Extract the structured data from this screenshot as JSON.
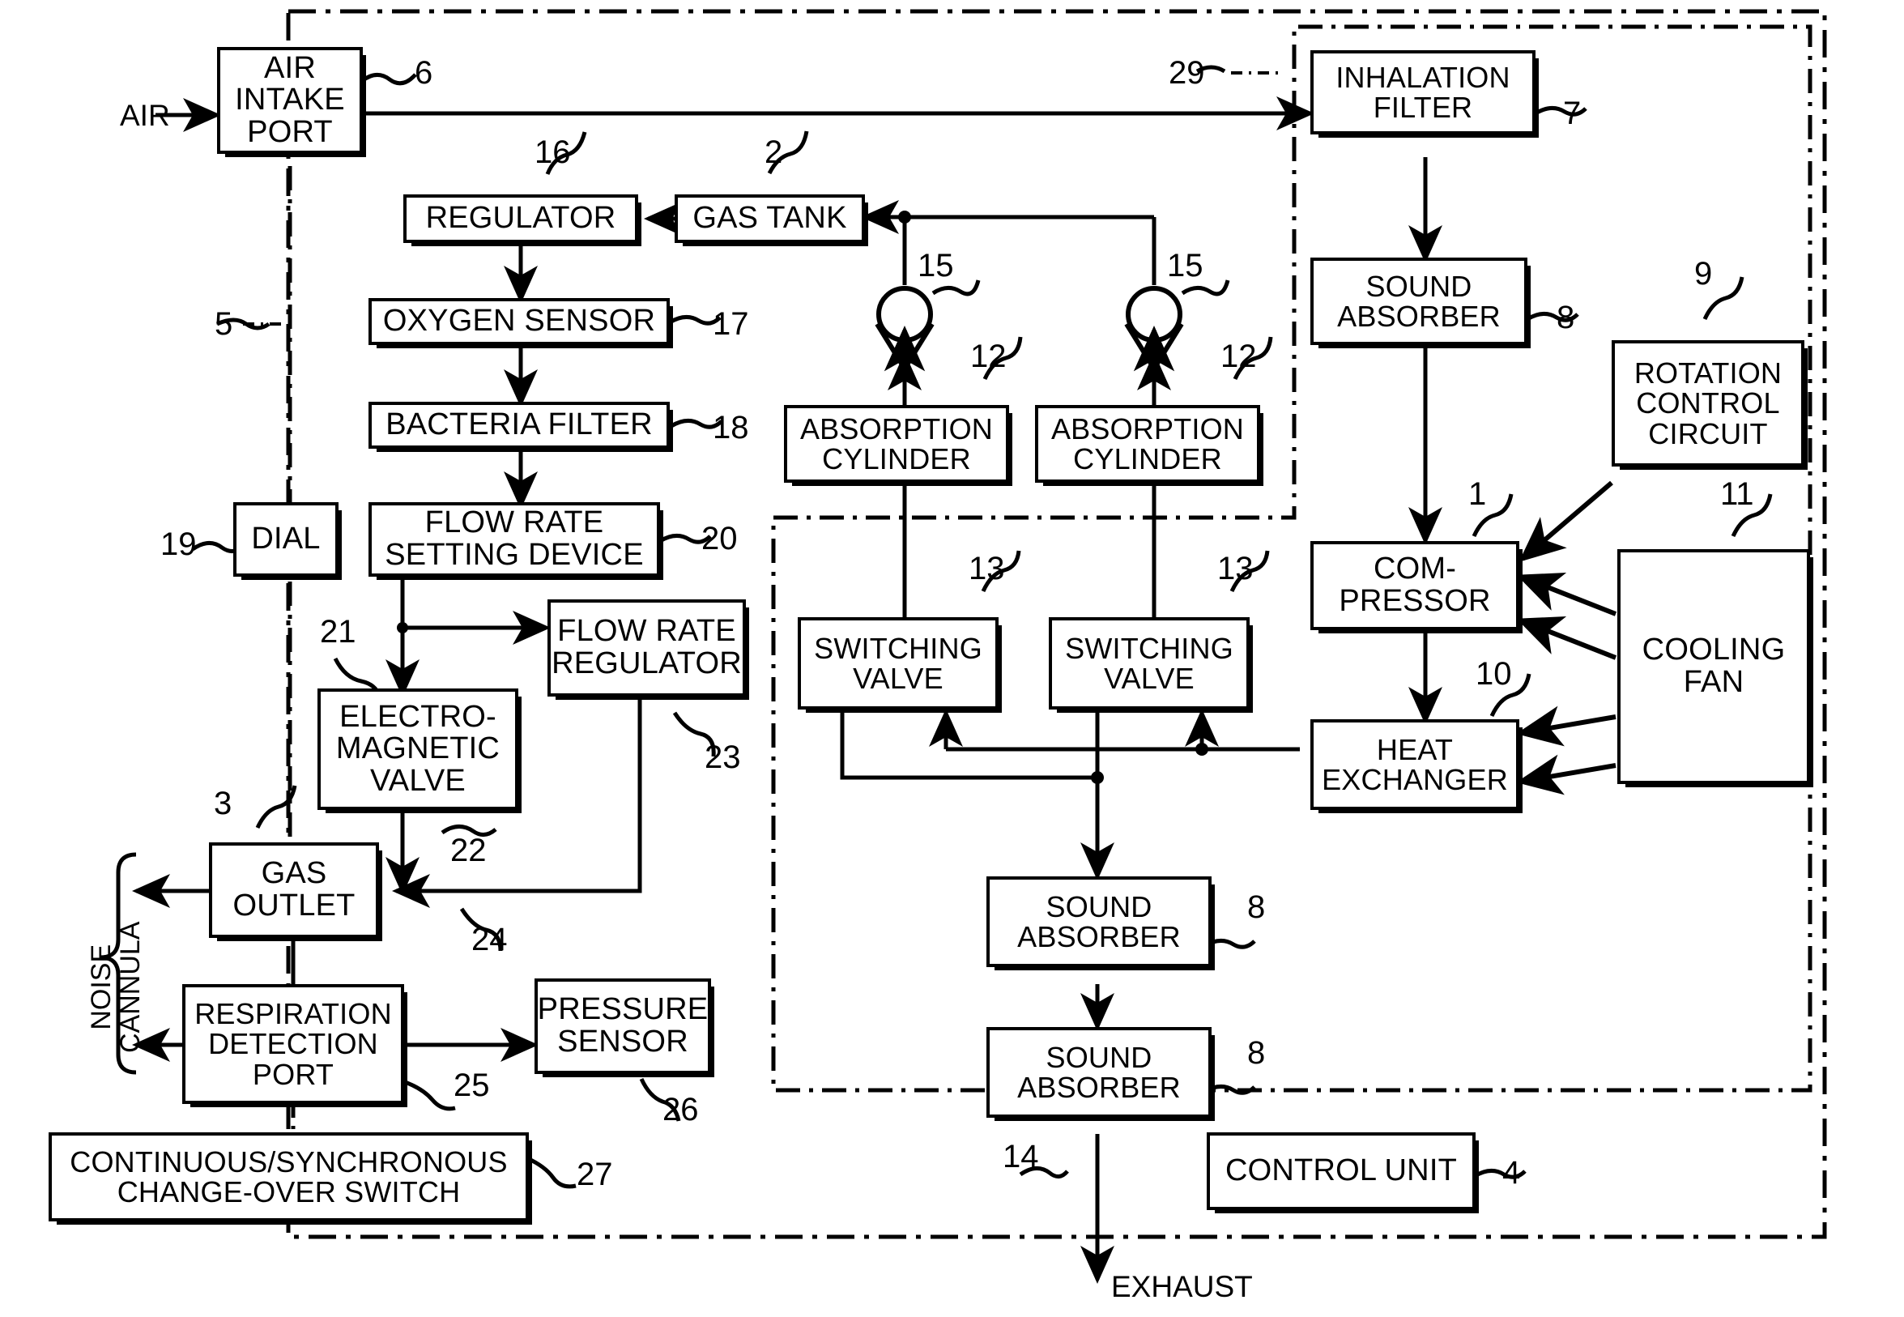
{
  "figure": {
    "type": "patent-block-diagram",
    "title": "Oxygen concentrator block diagram"
  },
  "labels": {
    "air_in": "AIR",
    "exhaust": "EXHAUST",
    "noise_cannula_line1": "NOISE",
    "noise_cannula_line2": "CANNULA"
  },
  "blocks": [
    {
      "id": "air-intake-port",
      "lines": [
        "AIR",
        "INTAKE",
        "PORT"
      ],
      "ref": "6"
    },
    {
      "id": "regulator",
      "lines": [
        "REGULATOR"
      ],
      "ref": "16"
    },
    {
      "id": "gas-tank",
      "lines": [
        "GAS TANK"
      ],
      "ref": "2"
    },
    {
      "id": "oxygen-sensor",
      "lines": [
        "OXYGEN SENSOR"
      ],
      "ref": "17"
    },
    {
      "id": "bacteria-filter",
      "lines": [
        "BACTERIA FILTER"
      ],
      "ref": "18"
    },
    {
      "id": "dial",
      "lines": [
        "DIAL"
      ],
      "ref": "19"
    },
    {
      "id": "flow-rate-setting-device",
      "lines": [
        "FLOW RATE",
        "SETTING DEVICE"
      ],
      "ref": "20"
    },
    {
      "id": "flow-rate-regulator",
      "lines": [
        "FLOW RATE",
        "REGULATOR"
      ],
      "ref": "23"
    },
    {
      "id": "electromagnetic-valve",
      "lines": [
        "ELECTRO-",
        "MAGNETIC",
        "VALVE"
      ],
      "ref": "21"
    },
    {
      "id": "gas-outlet",
      "lines": [
        "GAS",
        "OUTLET"
      ],
      "ref": "3"
    },
    {
      "id": "respiration-detection-port",
      "lines": [
        "RESPIRATION",
        "DETECTION",
        "PORT"
      ],
      "ref": "25"
    },
    {
      "id": "pressure-sensor",
      "lines": [
        "PRESSURE",
        "SENSOR"
      ],
      "ref": "26"
    },
    {
      "id": "changeover-switch",
      "lines": [
        "CONTINUOUS/SYNCHRONOUS",
        "CHANGE-OVER SWITCH"
      ],
      "ref": "27"
    },
    {
      "id": "absorption-cylinder-left",
      "lines": [
        "ABSORPTION",
        "CYLINDER"
      ],
      "ref": "12"
    },
    {
      "id": "absorption-cylinder-right",
      "lines": [
        "ABSORPTION",
        "CYLINDER"
      ],
      "ref": "12"
    },
    {
      "id": "switching-valve-left",
      "lines": [
        "SWITCHING",
        "VALVE"
      ],
      "ref": "13"
    },
    {
      "id": "switching-valve-right",
      "lines": [
        "SWITCHING",
        "VALVE"
      ],
      "ref": "13"
    },
    {
      "id": "sound-absorber-exhaust-1",
      "lines": [
        "SOUND",
        "ABSORBER"
      ],
      "ref": "8"
    },
    {
      "id": "sound-absorber-exhaust-2",
      "lines": [
        "SOUND",
        "ABSORBER"
      ],
      "ref": "8"
    },
    {
      "id": "inhalation-filter",
      "lines": [
        "INHALATION",
        "FILTER"
      ],
      "ref": "7"
    },
    {
      "id": "sound-absorber-intake",
      "lines": [
        "SOUND",
        "ABSORBER"
      ],
      "ref": "8"
    },
    {
      "id": "rotation-control-circuit",
      "lines": [
        "ROTATION",
        "CONTROL",
        "CIRCUIT"
      ],
      "ref": "9"
    },
    {
      "id": "compressor",
      "lines": [
        "COM-",
        "PRESSOR"
      ],
      "ref": "1"
    },
    {
      "id": "heat-exchanger",
      "lines": [
        "HEAT",
        "EXCHANGER"
      ],
      "ref": "10"
    },
    {
      "id": "cooling-fan",
      "lines": [
        "COOLING",
        "FAN"
      ],
      "ref": "11"
    },
    {
      "id": "control-unit",
      "lines": [
        "CONTROL UNIT"
      ],
      "ref": "4"
    }
  ],
  "blocks_text": {
    "air_intake_port": "AIR\nINTAKE\nPORT",
    "regulator": "REGULATOR",
    "gas_tank": "GAS TANK",
    "oxygen_sensor": "OXYGEN SENSOR",
    "bacteria_filter": "BACTERIA FILTER",
    "dial": "DIAL",
    "flow_rate_setting": "FLOW RATE\nSETTING DEVICE",
    "flow_rate_regulator": "FLOW RATE\nREGULATOR",
    "electromagnetic_valve": "ELECTRO-\nMAGNETIC\nVALVE",
    "gas_outlet": "GAS\nOUTLET",
    "respiration_port": "RESPIRATION\nDETECTION\nPORT",
    "pressure_sensor": "PRESSURE\nSENSOR",
    "changeover_switch": "CONTINUOUS/SYNCHRONOUS\nCHANGE-OVER SWITCH",
    "absorption_cylinder": "ABSORPTION\nCYLINDER",
    "switching_valve": "SWITCHING\nVALVE",
    "sound_absorber": "SOUND\nABSORBER",
    "inhalation_filter": "INHALATION\nFILTER",
    "rotation_control": "ROTATION\nCONTROL\nCIRCUIT",
    "compressor": "COM-\nPRESSOR",
    "heat_exchanger": "HEAT\nEXCHANGER",
    "cooling_fan": "COOLING\nFAN",
    "control_unit": "CONTROL UNIT"
  },
  "reference_numerals": {
    "compressor": "1",
    "gas_tank": "2",
    "gas_outlet": "3",
    "control_unit": "4",
    "housing_left": "5",
    "air_intake_port": "6",
    "inhalation_filter": "7",
    "sound_absorber": "8",
    "rotation_control_circuit": "9",
    "heat_exchanger": "10",
    "cooling_fan": "11",
    "absorption_cylinder": "12",
    "switching_valve": "13",
    "exhaust_line": "14",
    "check_valve": "15",
    "regulator": "16",
    "oxygen_sensor": "17",
    "bacteria_filter": "18",
    "dial": "19",
    "flow_rate_setting_device": "20",
    "electromagnetic_valve": "21",
    "valve_outlet_line": "22",
    "flow_rate_regulator": "23",
    "regulator_outlet_line": "24",
    "respiration_detection_port": "25",
    "pressure_sensor": "26",
    "changeover_switch": "27",
    "air_supply_line": "29"
  },
  "icons": {
    "check_valve": "check-valve-icon",
    "arrow": "arrow-icon"
  },
  "colors": {
    "ink": "#000000",
    "paper": "#ffffff"
  }
}
